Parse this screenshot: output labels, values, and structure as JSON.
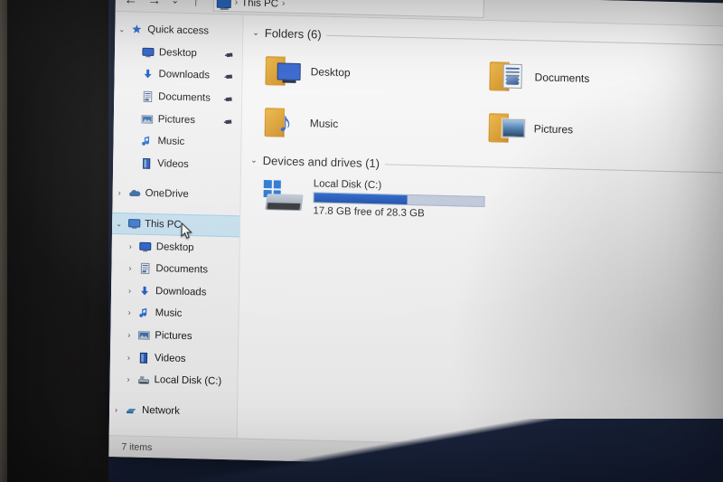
{
  "window": {
    "title": "This PC",
    "status_text": "7 items"
  },
  "toolbar": {
    "back_icon": "arrow-left-icon",
    "back_label": "←",
    "forward_icon": "arrow-right-icon",
    "forward_label": "→",
    "recent_icon": "chevron-down-icon",
    "recent_label": "⌄",
    "up_icon": "arrow-up-icon",
    "up_label": "↑"
  },
  "breadcrumb": {
    "computer_icon": "this-pc-monitor-icon",
    "crumb_label": "This PC",
    "separator": "›",
    "trailing_separator": "›"
  },
  "sidebar": {
    "quick_access": {
      "label": "Quick access",
      "icon": "star-pin-icon",
      "chevron": "⌄",
      "expanded": true,
      "items": [
        {
          "label": "Desktop",
          "icon": "desktop-monitor-icon",
          "pinned": true,
          "pin_glyph": "📌"
        },
        {
          "label": "Downloads",
          "icon": "download-arrow-icon",
          "pinned": true,
          "pin_glyph": "📌"
        },
        {
          "label": "Documents",
          "icon": "document-icon",
          "pinned": true,
          "pin_glyph": "📌"
        },
        {
          "label": "Pictures",
          "icon": "picture-icon",
          "pinned": true,
          "pin_glyph": "📌"
        },
        {
          "label": "Music",
          "icon": "music-note-icon",
          "pinned": false,
          "pin_glyph": ""
        },
        {
          "label": "Videos",
          "icon": "video-icon",
          "pinned": false,
          "pin_glyph": ""
        }
      ]
    },
    "onedrive": {
      "label": "OneDrive",
      "icon": "onedrive-cloud-icon",
      "chevron": "›",
      "expanded": false
    },
    "this_pc": {
      "label": "This PC",
      "icon": "this-pc-monitor-icon",
      "chevron": "⌄",
      "expanded": true,
      "selected": true,
      "items": [
        {
          "label": "Desktop",
          "icon": "desktop-monitor-icon",
          "chevron": "›"
        },
        {
          "label": "Documents",
          "icon": "document-icon",
          "chevron": "›"
        },
        {
          "label": "Downloads",
          "icon": "download-arrow-icon",
          "chevron": "›"
        },
        {
          "label": "Music",
          "icon": "music-note-icon",
          "chevron": "›"
        },
        {
          "label": "Pictures",
          "icon": "picture-icon",
          "chevron": "›"
        },
        {
          "label": "Videos",
          "icon": "video-icon",
          "chevron": "›"
        },
        {
          "label": "Local Disk (C:)",
          "icon": "hard-drive-icon",
          "chevron": "›"
        }
      ]
    },
    "network": {
      "label": "Network",
      "icon": "network-icon",
      "chevron": "›",
      "expanded": false
    }
  },
  "content": {
    "folders_group": {
      "title": "Folders (6)",
      "chevron": "⌄",
      "items": [
        {
          "label": "Desktop",
          "icon": "folder-desktop-icon",
          "badge": "monitor"
        },
        {
          "label": "Documents",
          "icon": "folder-documents-icon",
          "badge": "doc"
        },
        {
          "label": "Music",
          "icon": "folder-music-icon",
          "badge": "note"
        },
        {
          "label": "Pictures",
          "icon": "folder-pictures-icon",
          "badge": "pic"
        }
      ]
    },
    "drives_group": {
      "title": "Devices and drives (1)",
      "chevron": "⌄",
      "drive": {
        "name": "Local Disk (C:)",
        "icon": "windows-hard-drive-icon",
        "capacity_text": "17.8 GB free of 28.3 GB",
        "free_gb": 17.8,
        "total_gb": 28.3,
        "used_percent": 55
      }
    }
  },
  "cursor": {
    "icon": "mouse-pointer-icon"
  },
  "colors": {
    "selection_blue": "#cde8f7",
    "folder_yellow": "#e0a02c",
    "bar_fill_blue": "#1a5fd0",
    "bar_track_blue": "#c4cfe2",
    "desktop_navy": "#1f2a44"
  }
}
